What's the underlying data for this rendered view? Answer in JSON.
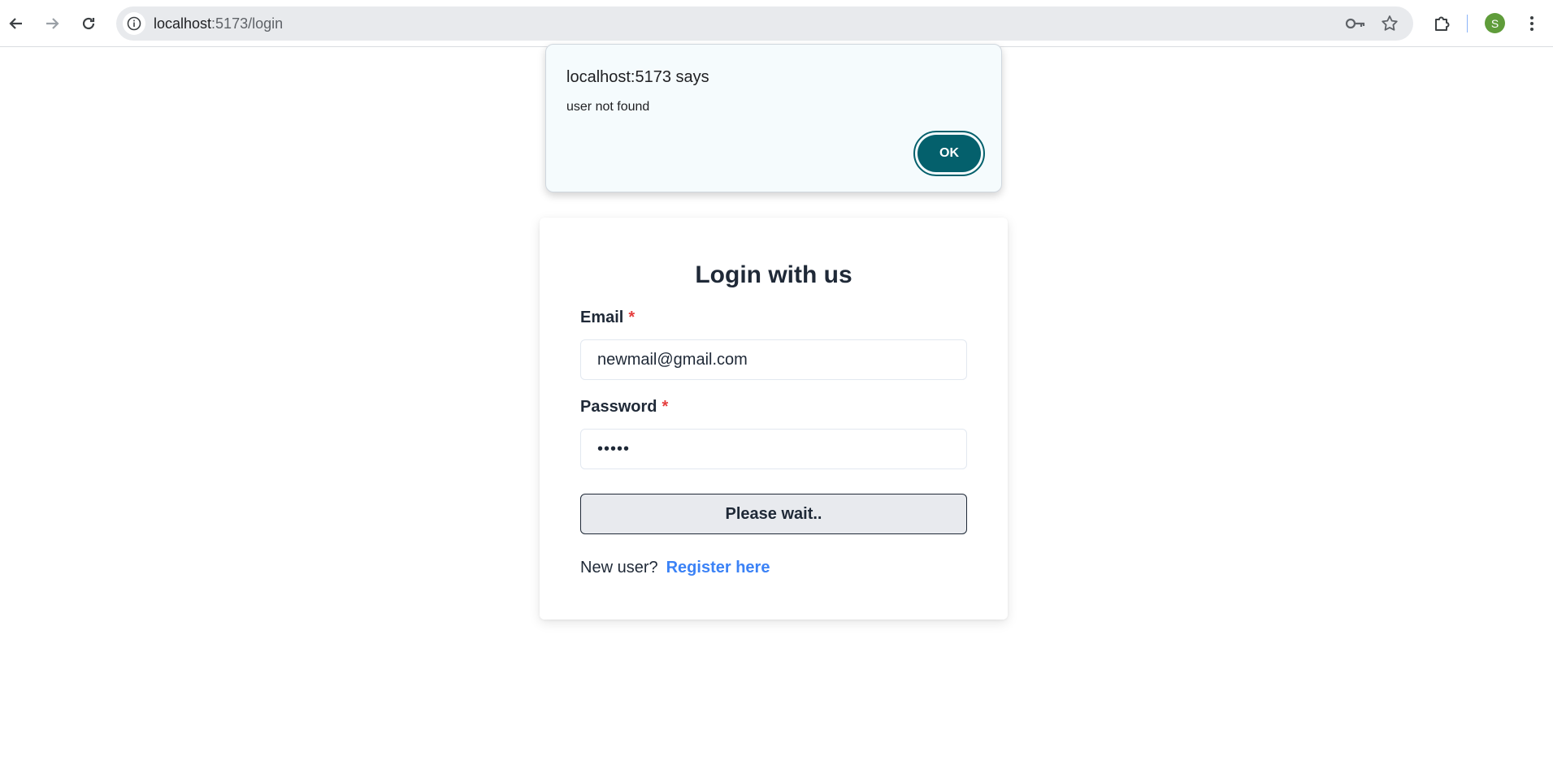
{
  "browser": {
    "url_host": "localhost",
    "url_path": ":5173/login",
    "profile_initial": "S",
    "icons": [
      "back-arrow-icon",
      "forward-arrow-icon",
      "reload-icon",
      "site-info-icon",
      "password-key-icon",
      "bookmark-star-icon",
      "extensions-puzzle-icon",
      "kebab-menu-icon"
    ]
  },
  "dialog": {
    "title": "localhost:5173 says",
    "message": "user not found",
    "ok_label": "OK",
    "accent": "#04606c"
  },
  "login": {
    "title": "Login with us",
    "email_label": "Email",
    "required_mark": "*",
    "email_value": "newmail@gmail.com",
    "password_label": "Password",
    "password_value": "•••••",
    "submit_label": "Please wait..",
    "new_user_text": "New user?",
    "register_link": "Register here",
    "link_color": "#3b82f6",
    "required_color": "#e53e3e"
  }
}
